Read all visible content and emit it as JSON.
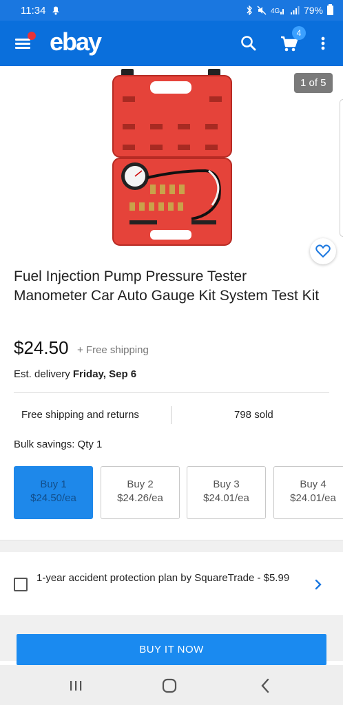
{
  "status_bar": {
    "time": "11:34",
    "battery": "79%",
    "icons": [
      "notification-icon",
      "bluetooth-icon",
      "mute-icon",
      "lte-icon",
      "signal-icon",
      "battery-icon"
    ]
  },
  "app_bar": {
    "logo": "ebay",
    "cart_count": "4",
    "icons": [
      "menu-icon",
      "search-icon",
      "cart-icon",
      "more-icon"
    ]
  },
  "gallery": {
    "counter": "1 of 5",
    "favorite_icon": "heart-icon"
  },
  "product": {
    "title": "Fuel Injection Pump Pressure Tester Manometer Car Auto Gauge Kit System Test Kit",
    "price": "$24.50",
    "shipping": "+ Free shipping",
    "delivery_prefix": "Est. delivery ",
    "delivery_date": "Friday, Sep 6"
  },
  "features": {
    "returns": "Free shipping and returns",
    "sold": "798 sold"
  },
  "bulk": {
    "label": "Bulk savings: Qty 1",
    "options": [
      {
        "qty": "Buy 1",
        "price": "$24.50/ea"
      },
      {
        "qty": "Buy 2",
        "price": "$24.26/ea"
      },
      {
        "qty": "Buy 3",
        "price": "$24.01/ea"
      },
      {
        "qty": "Buy 4",
        "price": "$24.01/ea"
      }
    ]
  },
  "protection": {
    "text": "1-year accident protection plan by SquareTrade - $5.99"
  },
  "buy_now": "BUY IT NOW",
  "colors": {
    "brand_blue": "#0a6fdc",
    "button_blue": "#1a8af0",
    "case_red": "#e5433a"
  }
}
